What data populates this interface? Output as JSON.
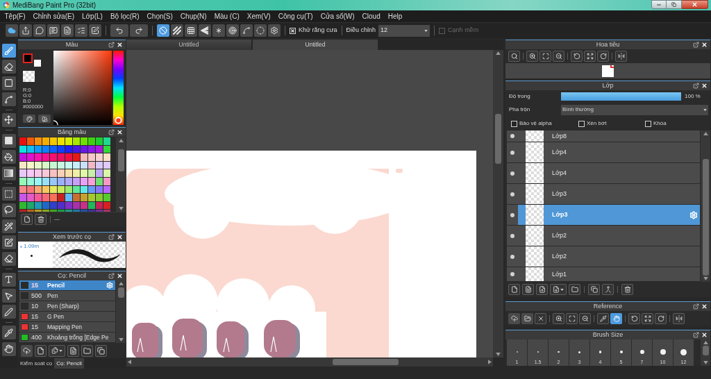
{
  "window": {
    "title": "MediBang Paint Pro (32bit)"
  },
  "menu": [
    "Tệp(F)",
    "Chỉnh sửa(E)",
    "Lớp(L)",
    "Bộ lọc(R)",
    "Chọn(S)",
    "Chụp(N)",
    "Màu (C)",
    "Xem(V)",
    "Công cụ(T)",
    "Cửa sổ(W)",
    "Cloud",
    "Help"
  ],
  "toolbar": {
    "snap_modes": [
      {
        "selected": true
      },
      {
        "selected": false
      },
      {
        "selected": false
      },
      {
        "selected": false
      },
      {
        "selected": false
      },
      {
        "selected": false
      },
      {
        "selected": false
      },
      {
        "selected": false
      }
    ],
    "antialias": {
      "label": "Khử răng cưa",
      "checked": true
    },
    "correction": {
      "label": "Điều chỉnh",
      "value": "12"
    },
    "soft_edge": {
      "label": "Cạnh mềm",
      "checked": false,
      "disabled": true
    }
  },
  "tools": [
    {
      "selected": true
    },
    {
      "selected": false
    },
    {
      "selected": false
    },
    {
      "selected": false
    },
    {
      "selected": false
    },
    {
      "selected": false
    },
    {
      "selected": false
    },
    {
      "selected": false
    },
    {
      "selected": false
    },
    {
      "selected": false
    },
    {
      "selected": false
    },
    {
      "selected": false
    },
    {
      "selected": false
    },
    {
      "selected": false
    },
    {
      "selected": false
    },
    {
      "selected": false
    },
    {
      "selected": false
    },
    {
      "selected": false
    }
  ],
  "color_panel": {
    "title": "Màu",
    "swatches": [
      {
        "color": "#000000",
        "selected": true
      },
      {
        "color": "#ffffff",
        "selected": false
      }
    ],
    "readout": [
      "R:0",
      "G:0",
      "B:0",
      "#000000"
    ],
    "hue": {
      "level": 1
    }
  },
  "palette": {
    "title": "Bảng màu",
    "swatches": [
      {
        "color": "#e81010"
      },
      {
        "color": "#f05a0a"
      },
      {
        "color": "#f5900a"
      },
      {
        "color": "#f5ae00"
      },
      {
        "color": "#f5c800"
      },
      {
        "color": "#f0e000"
      },
      {
        "color": "#d8f000"
      },
      {
        "color": "#a8e800"
      },
      {
        "color": "#70e000"
      },
      {
        "color": "#40d010"
      },
      {
        "color": "#20cc30"
      },
      {
        "color": "#20d890"
      },
      {
        "color": "#10e0e0"
      },
      {
        "color": "#10c0f0"
      },
      {
        "color": "#1098f8"
      },
      {
        "color": "#1080ff"
      },
      {
        "color": "#1060ff"
      },
      {
        "color": "#1040f8"
      },
      {
        "color": "#2020f0"
      },
      {
        "color": "#4818e8"
      },
      {
        "color": "#6818e8"
      },
      {
        "color": "#8818e8"
      },
      {
        "color": "#a818e0"
      },
      {
        "color": "#30d838"
      },
      {
        "color": "#c010e0"
      },
      {
        "color": "#e010d0"
      },
      {
        "color": "#f810b0"
      },
      {
        "color": "#f81090"
      },
      {
        "color": "#f81070"
      },
      {
        "color": "#e81060"
      },
      {
        "color": "#f01040"
      },
      {
        "color": "#e81818"
      },
      {
        "color": "#f8b8b8"
      },
      {
        "color": "#f8c8c8"
      },
      {
        "color": "#f8d0d0"
      },
      {
        "color": "#f8e0c8"
      },
      {
        "color": "#f8e8c8"
      },
      {
        "color": "#f8f8c8"
      },
      {
        "color": "#e8f8c8"
      },
      {
        "color": "#d8f8c8"
      },
      {
        "color": "#c8f8d0"
      },
      {
        "color": "#c8f8e0"
      },
      {
        "color": "#c8f8f0"
      },
      {
        "color": "#c8f0f8"
      },
      {
        "color": "#c8e0f8"
      },
      {
        "color": "#f0b8c8"
      },
      {
        "color": "#d8c8f8"
      },
      {
        "color": "#e0c8f8"
      },
      {
        "color": "#e8c8f8"
      },
      {
        "color": "#f8c8f8"
      },
      {
        "color": "#f8c8e8"
      },
      {
        "color": "#f8c8d8"
      },
      {
        "color": "#f8c0c0"
      },
      {
        "color": "#f8d0b8"
      },
      {
        "color": "#f8e0a8"
      },
      {
        "color": "#f0f0a8"
      },
      {
        "color": "#e0f8a8"
      },
      {
        "color": "#c8f0a8"
      },
      {
        "color": "#c0a8f8"
      },
      {
        "color": "#d8f8a8"
      },
      {
        "color": "#98f8b8"
      },
      {
        "color": "#98f8d8"
      },
      {
        "color": "#98f8f8"
      },
      {
        "color": "#98e0f8"
      },
      {
        "color": "#98c8f8"
      },
      {
        "color": "#98b0f8"
      },
      {
        "color": "#b0a8f8"
      },
      {
        "color": "#c8a0f8"
      },
      {
        "color": "#e8a0f8"
      },
      {
        "color": "#f8a0d8"
      },
      {
        "color": "#70e070"
      },
      {
        "color": "#f898c8"
      },
      {
        "color": "#f88888"
      },
      {
        "color": "#f87878"
      },
      {
        "color": "#f8a870"
      },
      {
        "color": "#f8c860"
      },
      {
        "color": "#e8e860"
      },
      {
        "color": "#c8e860"
      },
      {
        "color": "#98e870"
      },
      {
        "color": "#60e898"
      },
      {
        "color": "#60e8e8"
      },
      {
        "color": "#6898f8"
      },
      {
        "color": "#8878f8"
      },
      {
        "color": "#b868f8"
      },
      {
        "color": "#c858e8"
      },
      {
        "color": "#e858c8"
      },
      {
        "color": "#f85898"
      },
      {
        "color": "#f86878"
      },
      {
        "color": "#f87058"
      },
      {
        "color": "#c82020"
      },
      {
        "color": "#60b8f8"
      },
      {
        "color": "#c87030"
      },
      {
        "color": "#c8a030"
      },
      {
        "color": "#a8c830"
      },
      {
        "color": "#88c830"
      },
      {
        "color": "#58c830"
      },
      {
        "color": "#30b830"
      },
      {
        "color": "#20a868"
      },
      {
        "color": "#2098b8"
      },
      {
        "color": "#2068c8"
      },
      {
        "color": "#3040c8"
      },
      {
        "color": "#5030c8"
      },
      {
        "color": "#8030c8"
      },
      {
        "color": "#a830a8"
      },
      {
        "color": "#c83088"
      },
      {
        "color": "#20b858"
      },
      {
        "color": "#c82058"
      },
      {
        "color": "#d82020"
      },
      {
        "color": "#b82020"
      },
      {
        "color": "#b86020"
      },
      {
        "color": "#b8a020"
      },
      {
        "color": "#88a820"
      },
      {
        "color": "#40a820"
      },
      {
        "color": "#209848"
      },
      {
        "color": "#209888"
      },
      {
        "color": "#2078a8"
      },
      {
        "color": "#2050a8"
      },
      {
        "color": "#403098"
      },
      {
        "color": "#703098"
      },
      {
        "color": "#a83068"
      }
    ],
    "name": "---"
  },
  "brush_preview": {
    "title": "Xem trước cọ",
    "size": "1.09m"
  },
  "brushes": {
    "title": "Cọ: Pencil",
    "items": [
      {
        "color": "#2b2b2b",
        "size": "15",
        "name": "Pencil",
        "selected": true
      },
      {
        "color": "#2b2b2b",
        "size": "500",
        "name": "Pen",
        "selected": false
      },
      {
        "color": "#2b2b2b",
        "size": "10",
        "name": "Pen (Sharp)",
        "selected": false
      },
      {
        "color": "#ee3333",
        "size": "15",
        "name": "G Pen",
        "selected": false
      },
      {
        "color": "#ee3333",
        "size": "15",
        "name": "Mapping Pen",
        "selected": false
      },
      {
        "color": "#22bb22",
        "size": "400",
        "name": "Khoảng trống [Edge Pe",
        "selected": false
      }
    ]
  },
  "left_tabs": [
    {
      "label": "Kiểm soát cọ",
      "selected": false
    },
    {
      "label": "Cọ: Pencil",
      "selected": true
    }
  ],
  "document_tabs": [
    {
      "label": "Untitled",
      "selected": false
    },
    {
      "label": "Untitled",
      "selected": true
    }
  ],
  "navigator": {
    "title": "Hoa tiêu"
  },
  "layer_panel": {
    "title": "Lớp",
    "opacity": {
      "label": "Độ trong",
      "level": 1,
      "reading": "100 %"
    },
    "blend": {
      "label": "Pha trộn",
      "value": "Bình thường"
    },
    "options": [
      {
        "label": "Bảo vệ alpha",
        "checked": false
      },
      {
        "label": "Xén bớt",
        "checked": false
      },
      {
        "label": "Khóa",
        "checked": false
      }
    ],
    "layers": [
      {
        "name": "Lớp8",
        "selected": false,
        "visible": true
      },
      {
        "name": "Lớp4",
        "selected": false,
        "visible": true
      },
      {
        "name": "Lớp4",
        "selected": false,
        "visible": true
      },
      {
        "name": "Lớp3",
        "selected": false,
        "visible": true
      },
      {
        "name": "Lớp3",
        "selected": true,
        "visible": true
      },
      {
        "name": "Lớp2",
        "selected": false,
        "visible": true
      },
      {
        "name": "Lớp2",
        "selected": false,
        "visible": true
      },
      {
        "name": "Lớp1",
        "selected": false,
        "visible": true
      }
    ]
  },
  "reference": {
    "title": "Reference",
    "tools": [
      {
        "selected": false
      },
      {
        "selected": false
      },
      {
        "selected": false
      },
      {
        "selected": false
      },
      {
        "selected": false
      },
      {
        "selected": false
      },
      {
        "selected": false
      },
      {
        "selected": true
      },
      {
        "selected": false
      },
      {
        "selected": false
      },
      {
        "selected": false
      },
      {
        "selected": false
      }
    ]
  },
  "brush_size": {
    "title": "Brush Size",
    "sizes": [
      "1",
      "1.5",
      "2",
      "3",
      "4",
      "5",
      "7",
      "10",
      "12"
    ]
  }
}
